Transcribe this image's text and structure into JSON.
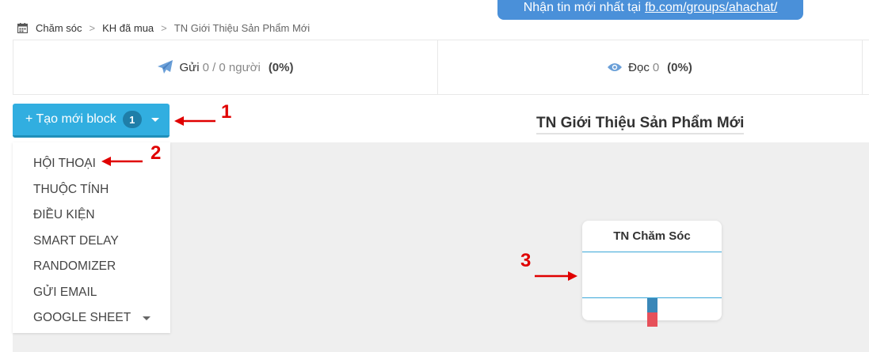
{
  "banner": {
    "text": "Nhận tin mới nhất tại",
    "link": "fb.com/groups/ahachat/"
  },
  "breadcrumb": {
    "items": [
      "Chăm sóc",
      "KH đã mua",
      "TN Giới Thiệu Sản Phẩm Mới"
    ],
    "separator": ">"
  },
  "stats": {
    "sent": {
      "label": "Gửi",
      "value": "0 / 0 người",
      "percent": "(0%)",
      "icon": "paper-plane-icon"
    },
    "read": {
      "label": "Đọc",
      "value": "0",
      "percent": "(0%)",
      "icon": "eye-icon"
    }
  },
  "toolbar": {
    "new_block_label": "+ Tạo mới block",
    "new_block_count": "1"
  },
  "flow": {
    "title": "TN Giới Thiệu Sản Phẩm Mới"
  },
  "dropdown": {
    "items": [
      "HỘI THOẠI",
      "THUỘC TÍNH",
      "ĐIỀU KIỆN",
      "SMART DELAY",
      "RANDOMIZER",
      "GỬI EMAIL",
      "GOOGLE SHEET"
    ]
  },
  "node": {
    "title": "TN Chăm Sóc"
  },
  "annotations": [
    "1",
    "2",
    "3"
  ],
  "colors": {
    "accent": "#31aee0",
    "banner": "#4a90d9",
    "annotation": "#e00000",
    "connector_top": "#3a87b8",
    "connector_bottom": "#e6505a"
  }
}
